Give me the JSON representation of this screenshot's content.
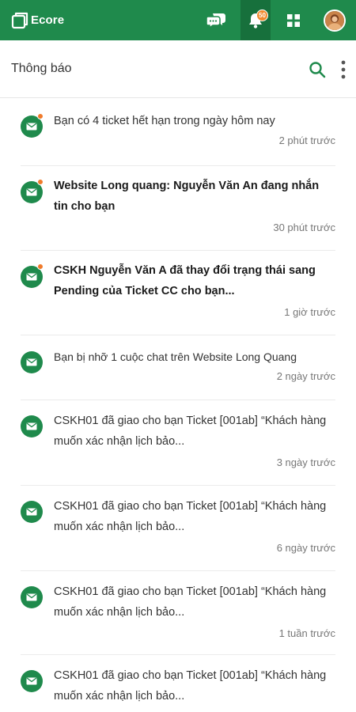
{
  "app": {
    "brand": "Ecore",
    "notification_count": "50"
  },
  "colors": {
    "primary": "#1f8a4c",
    "primary_dark": "#17703c",
    "badge": "#f28a2e",
    "unread_dot": "#f07a2b"
  },
  "header": {
    "title": "Thông báo"
  },
  "notifications": [
    {
      "text": "Bạn có 4 ticket hết hạn trong ngày hôm nay",
      "time": "2 phút trước",
      "unread": true,
      "bold": false
    },
    {
      "text": "Website Long quang: Nguyễn Văn An đang nhắn tin cho bạn",
      "time": "30 phút trước",
      "unread": true,
      "bold": true
    },
    {
      "text": "CSKH Nguyễn Văn A đã thay đổi trạng thái sang Pending của Ticket CC cho bạn...",
      "time": "1 giờ trước",
      "unread": true,
      "bold": true
    },
    {
      "text": "Bạn bị nhỡ 1 cuộc chat trên Website Long Quang",
      "time": "2 ngày trước",
      "unread": false,
      "bold": false
    },
    {
      "text": "CSKH01 đã giao cho bạn Ticket [001ab] “Khách hàng muốn xác nhận lịch bảo...",
      "time": "3 ngày trước",
      "unread": false,
      "bold": false
    },
    {
      "text": "CSKH01 đã giao cho bạn Ticket [001ab] “Khách hàng muốn xác nhận lịch bảo...",
      "time": "6 ngày trước",
      "unread": false,
      "bold": false
    },
    {
      "text": "CSKH01 đã giao cho bạn Ticket [001ab] “Khách hàng muốn xác nhận lịch bảo...",
      "time": "1 tuần trước",
      "unread": false,
      "bold": false
    },
    {
      "text": "CSKH01 đã giao cho bạn Ticket [001ab] “Khách hàng muốn xác nhận lịch bảo...",
      "time": "",
      "unread": false,
      "bold": false
    }
  ]
}
